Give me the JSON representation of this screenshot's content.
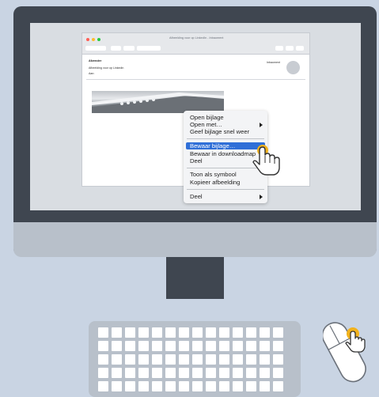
{
  "window": {
    "title": "Afbeelding voor op LinkedIn - Inbaoment"
  },
  "email": {
    "from": "Afzender",
    "subject": "Afbeelding voor op Linkedin",
    "to": "Aan:",
    "folder": "Inbaoment"
  },
  "context_menu": {
    "items": [
      {
        "label": "Open bijlage"
      },
      {
        "label": "Open met…",
        "submenu": true
      },
      {
        "label": "Geef bijlage snel weer"
      },
      {
        "label": "Bewaar bijlage…",
        "selected": true
      },
      {
        "label": "Bewaar in downloadmap"
      },
      {
        "label": "Deel"
      },
      {
        "label": "Toon als symbool"
      },
      {
        "label": "Kopieer afbeelding"
      },
      {
        "label": "Deel",
        "submenu": true
      }
    ]
  },
  "colors": {
    "background": "#c9d4e3",
    "monitor": "#3f4650",
    "highlight": "#2f6fd7",
    "pointer_accent": "#f2b21c"
  },
  "icons": {
    "cursor": "hand-pointer-icon",
    "mouse_cursor": "hand-pointer-icon"
  }
}
